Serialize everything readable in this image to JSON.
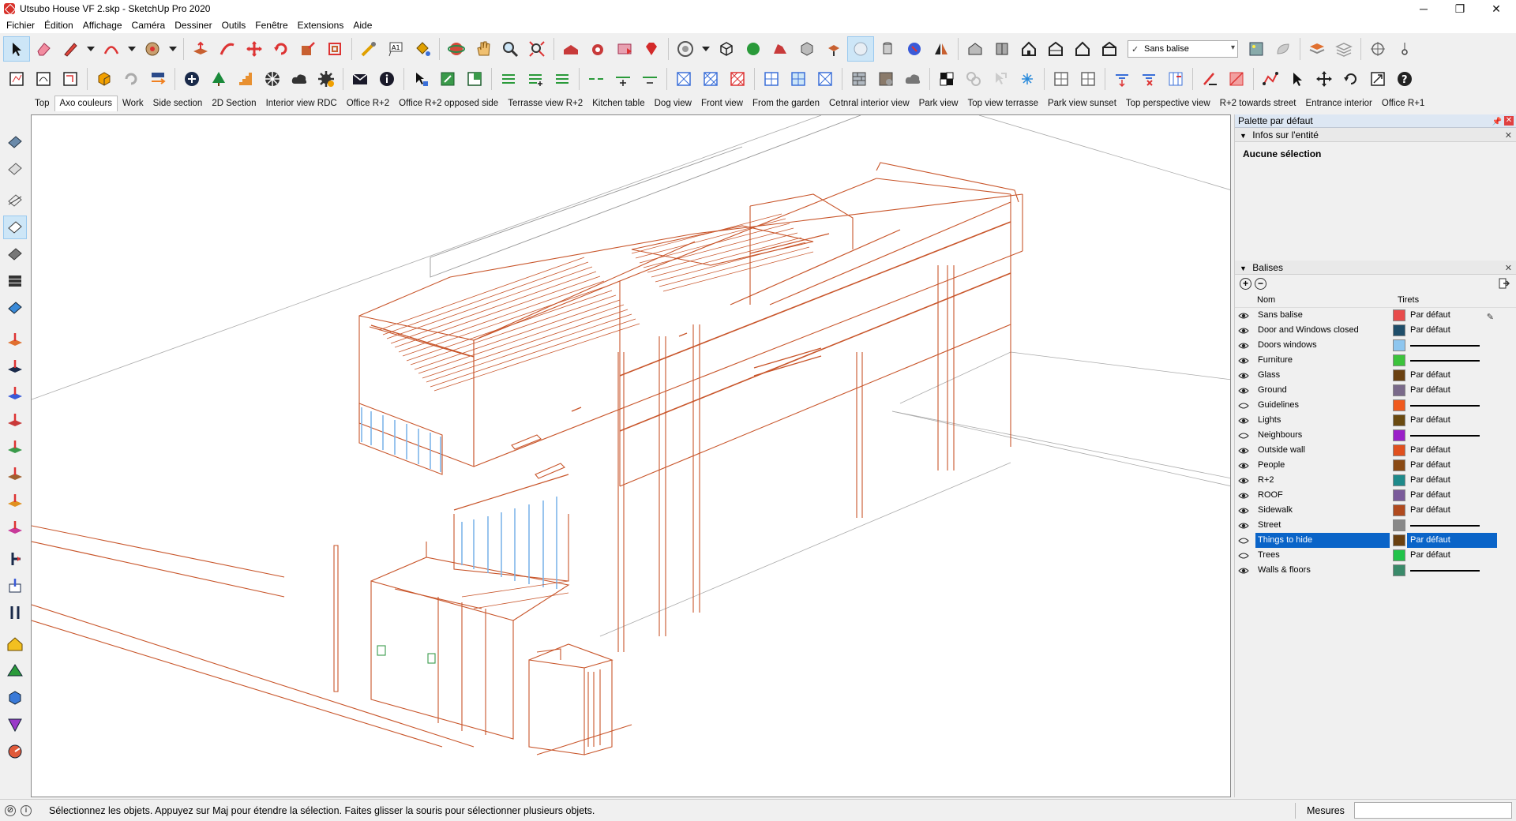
{
  "window": {
    "title": "Utsubo House VF 2.skp - SketchUp Pro 2020",
    "minimize": "─",
    "maximize": "❐",
    "close": "✕"
  },
  "menu": [
    "Fichier",
    "Édition",
    "Affichage",
    "Caméra",
    "Dessiner",
    "Outils",
    "Fenêtre",
    "Extensions",
    "Aide"
  ],
  "toolbar": {
    "tag_select": "Sans balise",
    "tag_check": "✓"
  },
  "scenes": [
    "Top",
    "Axo couleurs",
    "Work",
    "Side section",
    "2D Section",
    "Interior view RDC",
    "Office R+2",
    "Office R+2 opposed side",
    "Terrasse view R+2",
    "Kitchen table",
    "Dog view",
    "Front view",
    "From the garden",
    "Cetnral interior view",
    "Park view",
    "Top view terrasse",
    "Park view sunset",
    "Top perspective view",
    "R+2 towards street",
    "Entrance interior",
    "Office R+1"
  ],
  "selected_scene": "Axo couleurs",
  "tray": {
    "title": "Palette par défaut",
    "entity_info": {
      "header": "Infos sur l'entité",
      "content": "Aucune sélection"
    },
    "tags": {
      "header": "Balises",
      "col_name": "Nom",
      "col_dash": "Tirets",
      "rows": [
        {
          "name": "Sans balise",
          "visible": true,
          "color": "#e84c4c",
          "dash": "Par défaut",
          "solid": false
        },
        {
          "name": "Door and Windows closed",
          "visible": true,
          "color": "#1f4e6a",
          "dash": "Par défaut",
          "solid": false
        },
        {
          "name": "Doors windows",
          "visible": true,
          "color": "#8ec6ef",
          "dash": "",
          "solid": true
        },
        {
          "name": "Furniture",
          "visible": true,
          "color": "#3cc33c",
          "dash": "",
          "solid": true
        },
        {
          "name": "Glass",
          "visible": true,
          "color": "#6a4010",
          "dash": "Par défaut",
          "solid": false
        },
        {
          "name": "Ground",
          "visible": true,
          "color": "#7a6a8a",
          "dash": "Par défaut",
          "solid": false
        },
        {
          "name": "Guidelines",
          "visible": false,
          "color": "#f05a1e",
          "dash": "",
          "solid": true
        },
        {
          "name": "Lights",
          "visible": true,
          "color": "#6a4a10",
          "dash": "Par défaut",
          "solid": false
        },
        {
          "name": "Neighbours",
          "visible": false,
          "color": "#9a1ec8",
          "dash": "",
          "solid": true
        },
        {
          "name": "Outside wall",
          "visible": true,
          "color": "#e0501e",
          "dash": "Par défaut",
          "solid": false
        },
        {
          "name": "People",
          "visible": true,
          "color": "#8a4a14",
          "dash": "Par défaut",
          "solid": false
        },
        {
          "name": "R+2",
          "visible": true,
          "color": "#1e8a8a",
          "dash": "Par défaut",
          "solid": false
        },
        {
          "name": "ROOF",
          "visible": true,
          "color": "#7a5a9a",
          "dash": "Par défaut",
          "solid": false
        },
        {
          "name": "Sidewalk",
          "visible": true,
          "color": "#b04a1e",
          "dash": "Par défaut",
          "solid": false
        },
        {
          "name": "Street",
          "visible": true,
          "color": "#888888",
          "dash": "",
          "solid": true
        },
        {
          "name": "Things to hide",
          "visible": false,
          "color": "#6a4010",
          "dash": "Par défaut",
          "solid": false,
          "selected": true
        },
        {
          "name": "Trees",
          "visible": false,
          "color": "#22c34a",
          "dash": "Par défaut",
          "solid": false
        },
        {
          "name": "Walls & floors",
          "visible": true,
          "color": "#3a8a6a",
          "dash": "",
          "solid": true
        }
      ]
    }
  },
  "status": {
    "text": "Sélectionnez les objets. Appuyez sur Maj pour étendre la sélection. Faites glisser la souris pour sélectionner plusieurs objets.",
    "measures_label": "Mesures",
    "measures_value": ""
  },
  "colors": {
    "model_lines": "#c8552a",
    "glass": "#7fb6ea",
    "highlight": "#0a64c8"
  }
}
